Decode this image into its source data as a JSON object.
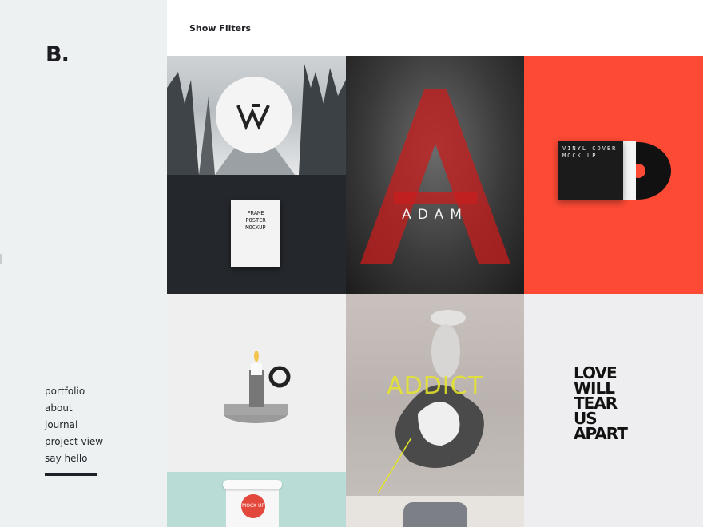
{
  "sidebar": {
    "logo": "B.",
    "nav": [
      "portfolio",
      "about",
      "journal",
      "project view",
      "say hello"
    ]
  },
  "header": {
    "filters_label": "Show Filters"
  },
  "grid": {
    "frame_poster": "FRAME POSTER MOCKUP",
    "cat_title": "ADAM",
    "vinyl_text": "VINYL COVER MOCK UP",
    "addict_title": "ADDICT",
    "type_lines": [
      "LOVE",
      "WILL",
      "TEAR",
      "US",
      "APART"
    ],
    "cup_badge": "MOCK UP"
  },
  "colors": {
    "sidebar_bg": "#eef1f2",
    "accent_red": "#fc4a35",
    "dark": "#24272c"
  }
}
